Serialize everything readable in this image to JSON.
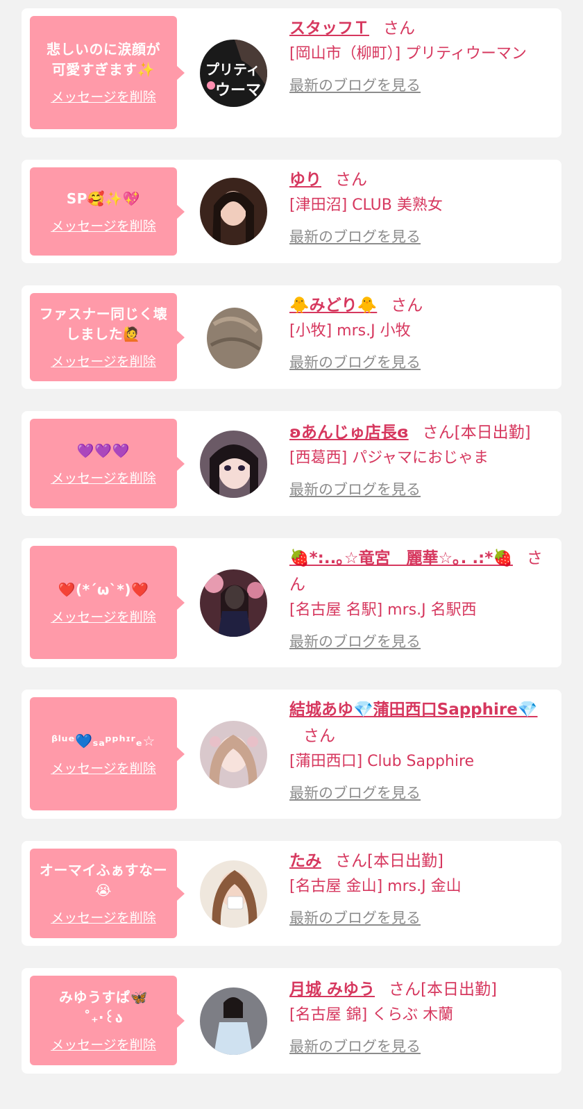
{
  "delete_label": "メッセージを削除",
  "blog_label": "最新のブログを見る",
  "san_suffix": "さん",
  "items": [
    {
      "message": "悲しいのに涙顔が可愛すぎます✨",
      "name": "スタッフＴ",
      "status": "",
      "shop": "[岡山市（柳町）] プリティウーマン",
      "avatar_icon": "avatar-pretty-woman-logo"
    },
    {
      "message": "SP🥰✨💖",
      "name": "ゆり",
      "status": "",
      "shop": "[津田沼] CLUB 美熟女",
      "avatar_icon": "avatar-photo"
    },
    {
      "message": "ファスナー同じく壊しました🙋",
      "name": "🐥みどり🐥",
      "status": "",
      "shop": "[小牧] mrs.J 小牧",
      "avatar_icon": "avatar-photo"
    },
    {
      "message": "💜💜💜",
      "name": "ʚあんじゅ店長ɞ",
      "status": "[本日出勤]",
      "shop": "[西葛西] パジャマにおじゃま",
      "avatar_icon": "avatar-photo"
    },
    {
      "message": "❤️(*´ω`*)❤️",
      "name": "🍓*:..｡☆竜宮　麗華☆｡. .:*🍓",
      "status": "",
      "shop": "[名古屋 名駅] mrs.J 名駅西",
      "avatar_icon": "avatar-photo"
    },
    {
      "message": "ᵝˡᵘᵉ💙ₛₐᵖᵖʰᶦʳₑ☆",
      "name": "結城あゆ💎蒲田西口Sapphire💎",
      "status": "",
      "shop": "[蒲田西口] Club Sapphire",
      "avatar_icon": "avatar-photo"
    },
    {
      "message": "オーマイふぁすなー😭",
      "name": "たみ",
      "status": "[本日出勤]",
      "shop": "[名古屋 金山] mrs.J 金山",
      "avatar_icon": "avatar-photo"
    },
    {
      "message": "みゆうすぱ🦋 ˚₊‧꒰ა",
      "name": "月城 みゆう",
      "status": "[本日出勤]",
      "shop": "[名古屋 錦] くらぶ 木蘭",
      "avatar_icon": "avatar-photo"
    }
  ]
}
